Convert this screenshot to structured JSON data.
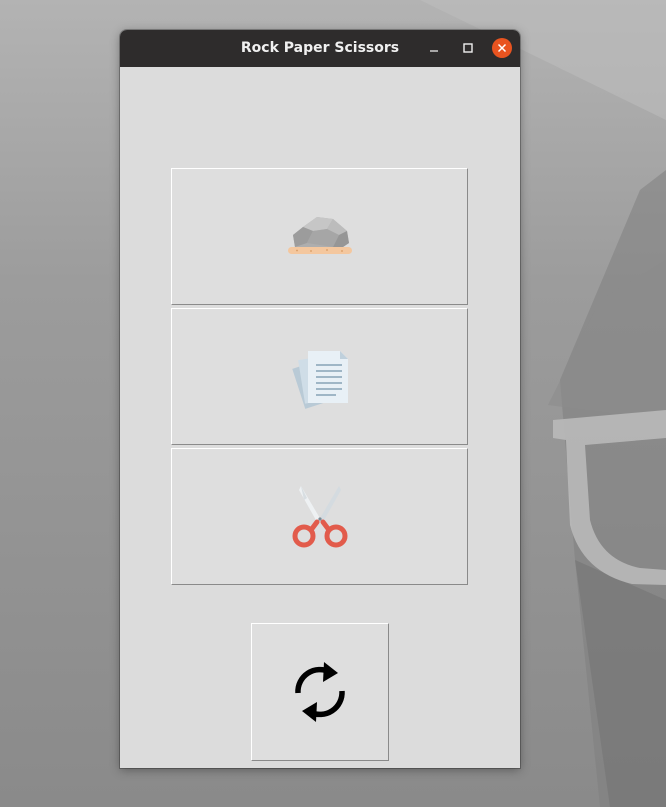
{
  "window": {
    "title": "Rock Paper Scissors",
    "controls": {
      "minimize_icon": "minimize-icon",
      "maximize_icon": "maximize-icon",
      "close_icon": "close-icon",
      "close_color": "#e95420"
    }
  },
  "choices": [
    {
      "name": "rock",
      "icon": "rock-icon"
    },
    {
      "name": "paper",
      "icon": "paper-icon"
    },
    {
      "name": "scissors",
      "icon": "scissors-icon"
    }
  ],
  "reset": {
    "icon": "refresh-icon"
  },
  "colors": {
    "titlebar": "#2e2c2c",
    "window_bg": "#dcdcdc",
    "scissors": "#e25b4b"
  }
}
